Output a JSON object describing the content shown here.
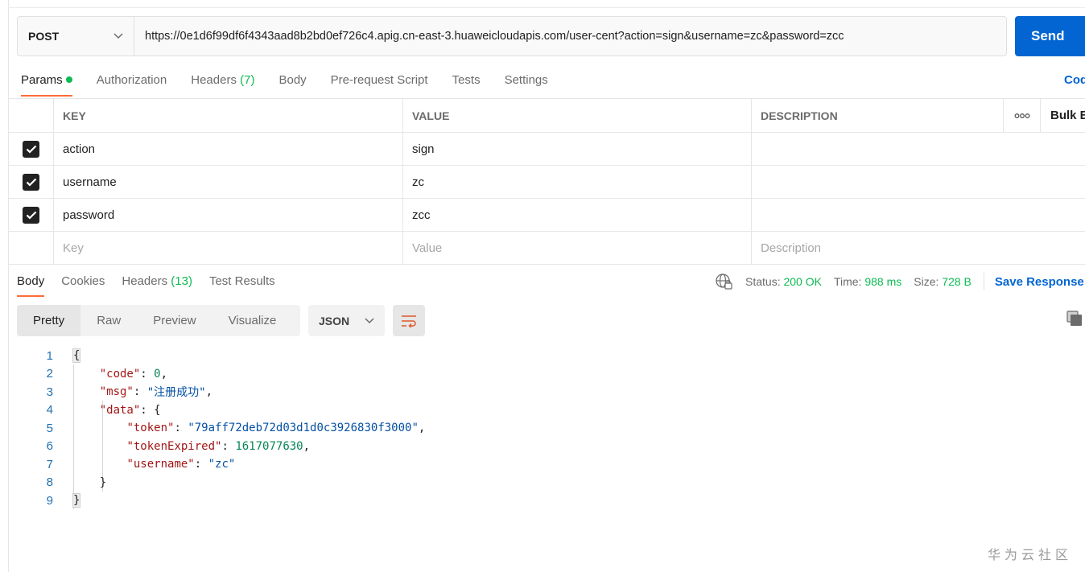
{
  "request": {
    "method": "POST",
    "url": "https://0e1d6f99df6f4343aad8b2bd0ef726c4.apig.cn-east-3.huaweicloudapis.com/user-cent?action=sign&username=zc&password=zcc",
    "send_label": "Send"
  },
  "req_tabs": {
    "params": "Params",
    "authorization": "Authorization",
    "headers": "Headers",
    "headers_count": "(7)",
    "body": "Body",
    "prerequest": "Pre-request Script",
    "tests": "Tests",
    "settings": "Settings",
    "code": "Code"
  },
  "params_table": {
    "headers": {
      "key": "KEY",
      "value": "VALUE",
      "description": "DESCRIPTION",
      "more": "ooo",
      "bulk": "Bulk Edit"
    },
    "rows": [
      {
        "key": "action",
        "value": "sign",
        "description": ""
      },
      {
        "key": "username",
        "value": "zc",
        "description": ""
      },
      {
        "key": "password",
        "value": "zcc",
        "description": ""
      }
    ],
    "placeholder": {
      "key": "Key",
      "value": "Value",
      "description": "Description"
    }
  },
  "res_tabs": {
    "body": "Body",
    "cookies": "Cookies",
    "headers": "Headers",
    "headers_count": "(13)",
    "test_results": "Test Results"
  },
  "status": {
    "status_label": "Status:",
    "status_value": "200 OK",
    "time_label": "Time:",
    "time_value": "988 ms",
    "size_label": "Size:",
    "size_value": "728 B",
    "save_response": "Save Response"
  },
  "viewer": {
    "modes": [
      "Pretty",
      "Raw",
      "Preview",
      "Visualize"
    ],
    "format": "JSON"
  },
  "code_lines": {
    "l1": "1",
    "l2": "2",
    "l3": "3",
    "l4": "4",
    "l5": "5",
    "l6": "6",
    "l7": "7",
    "l8": "8",
    "l9": "9",
    "open_brace": "{",
    "close_brace": "}",
    "code_key": "\"code\"",
    "code_val": "0",
    "msg_key": "\"msg\"",
    "msg_val": "\"注册成功\"",
    "data_key": "\"data\"",
    "token_key": "\"token\"",
    "token_val": "\"79aff72deb72d03d1d0c3926830f3000\"",
    "expired_key": "\"tokenExpired\"",
    "expired_val": "1617077630",
    "username_key": "\"username\"",
    "username_val": "\"zc\""
  },
  "watermark": "华为云社区",
  "colors": {
    "accent": "#ff6c37",
    "send_blue": "#0265d2",
    "status_green": "#0cbb52"
  }
}
